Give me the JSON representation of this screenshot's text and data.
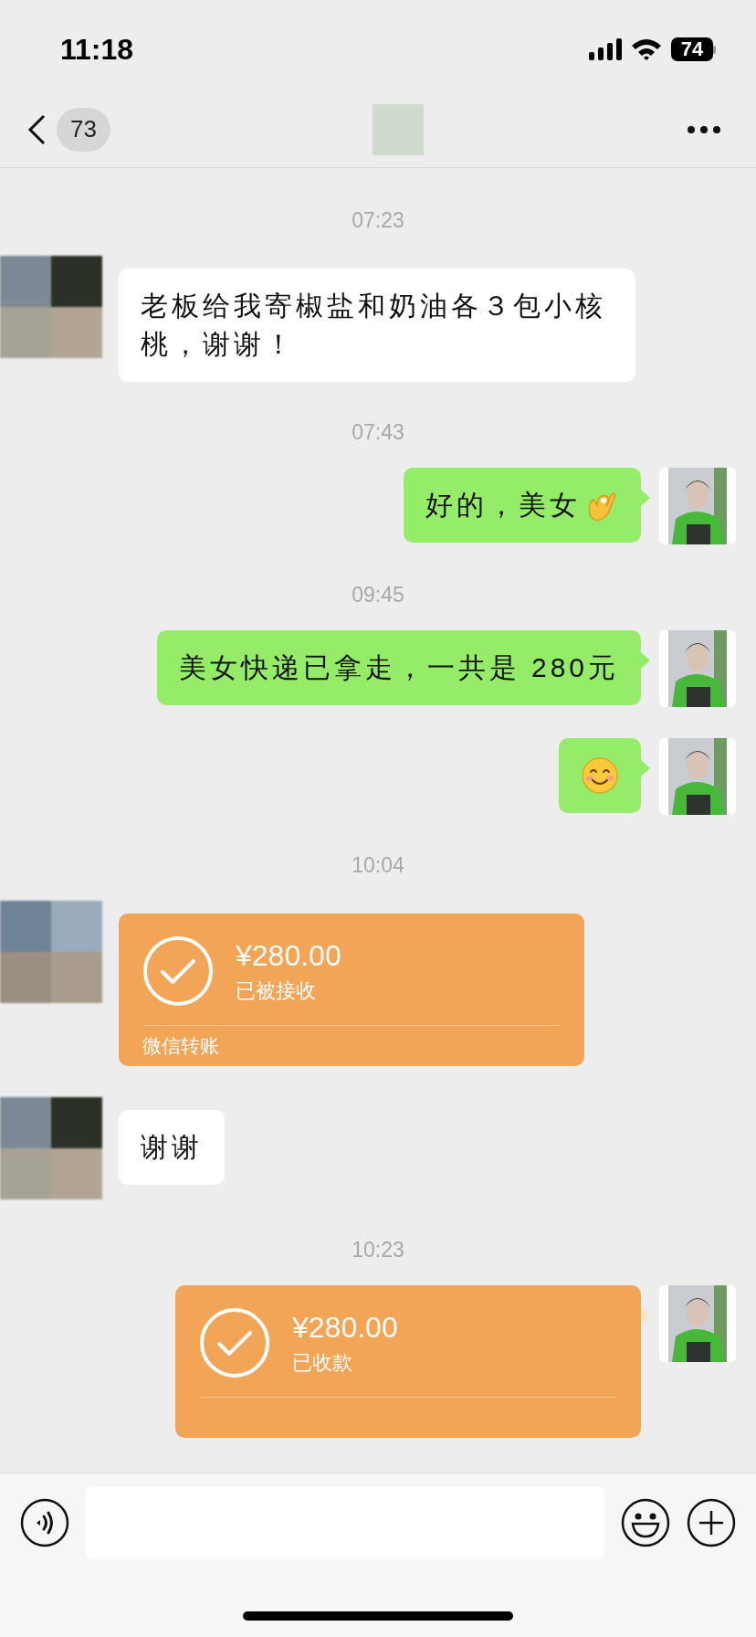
{
  "status_bar": {
    "time": "11:18",
    "battery": "74"
  },
  "nav": {
    "unread_count": "73"
  },
  "messages": [
    {
      "kind": "time",
      "text": "07:23"
    },
    {
      "kind": "text",
      "outgoing": false,
      "parts": [
        {
          "kind": "text",
          "text": "老板给我寄椒盐和奶油各３包小核桃，谢谢！"
        }
      ]
    },
    {
      "kind": "time",
      "text": "07:43"
    },
    {
      "kind": "text",
      "outgoing": true,
      "parts": [
        {
          "kind": "text",
          "text": "好的，美女"
        },
        {
          "kind": "ok_hand"
        }
      ]
    },
    {
      "kind": "time",
      "text": "09:45"
    },
    {
      "kind": "text",
      "outgoing": true,
      "parts": [
        {
          "kind": "text",
          "text": "美女快递已拿走，一共是 280元"
        }
      ]
    },
    {
      "kind": "text",
      "outgoing": true,
      "parts": [
        {
          "kind": "smile"
        }
      ]
    },
    {
      "kind": "time",
      "text": "10:04"
    },
    {
      "kind": "transfer",
      "outgoing": false,
      "amount": "¥280.00",
      "status": "已被接收",
      "footer": "微信转账"
    },
    {
      "kind": "text",
      "outgoing": false,
      "parts": [
        {
          "kind": "text",
          "text": "谢谢"
        }
      ]
    },
    {
      "kind": "time",
      "text": "10:23"
    },
    {
      "kind": "transfer",
      "outgoing": true,
      "amount": "¥280.00",
      "status": "已收款"
    }
  ]
}
